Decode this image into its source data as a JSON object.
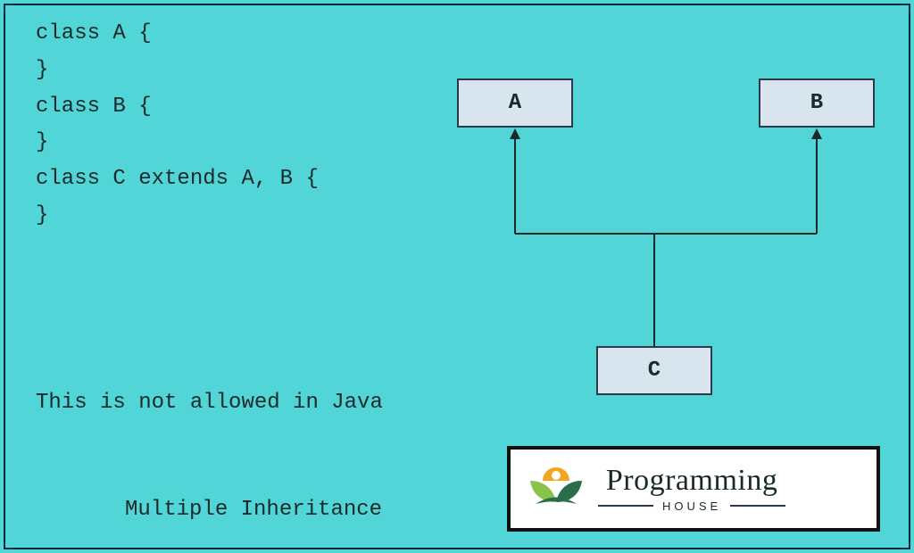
{
  "code": {
    "line1": "class A {",
    "line2": "",
    "line3": "}",
    "line4": "class B {",
    "line5": "",
    "line6": "}",
    "line7": "class C extends A, B {",
    "line8": "",
    "line9": "}"
  },
  "note": "This is not allowed in Java",
  "caption": "Multiple Inheritance",
  "diagram": {
    "boxA": "A",
    "boxB": "B",
    "boxC": "C"
  },
  "logo": {
    "main": "Programming",
    "sub": "HOUSE"
  },
  "colors": {
    "bg": "#51d5d7",
    "box_fill": "#d8e4ee",
    "border": "#1a2a2a",
    "logo_orange": "#f2a51d",
    "logo_green_light": "#8bc34a",
    "logo_green_dark": "#2a6d4b"
  }
}
